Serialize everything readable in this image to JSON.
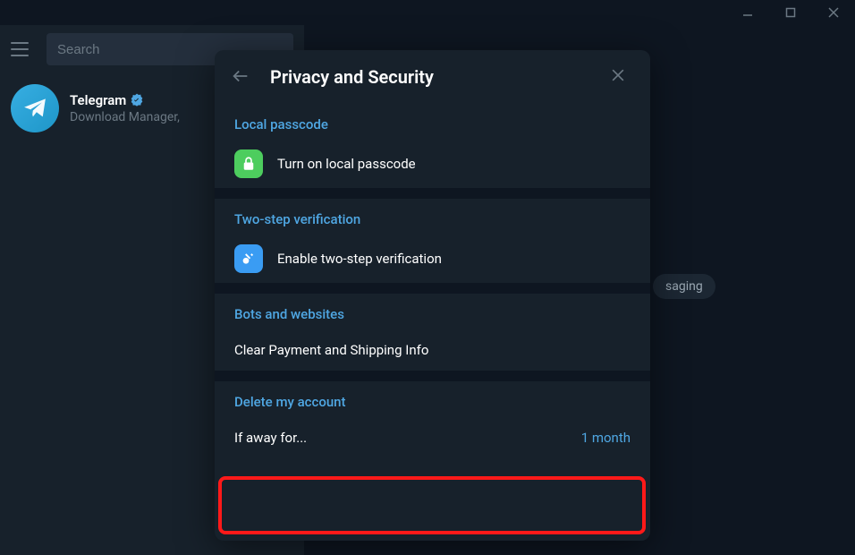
{
  "titlebar": {},
  "search": {
    "placeholder": "Search"
  },
  "chat_list": {
    "items": [
      {
        "title": "Telegram",
        "subtitle": "Download Manager,",
        "verified": true
      }
    ]
  },
  "background_pill": "saging",
  "modal": {
    "title": "Privacy and Security",
    "sections": {
      "local_passcode": {
        "header": "Local passcode",
        "item_label": "Turn on local passcode"
      },
      "two_step": {
        "header": "Two-step verification",
        "item_label": "Enable two-step verification"
      },
      "bots": {
        "header": "Bots and websites",
        "item_label": "Clear Payment and Shipping Info"
      },
      "delete_account": {
        "header": "Delete my account",
        "item_label": "If away for...",
        "item_value": "1 month"
      }
    }
  }
}
